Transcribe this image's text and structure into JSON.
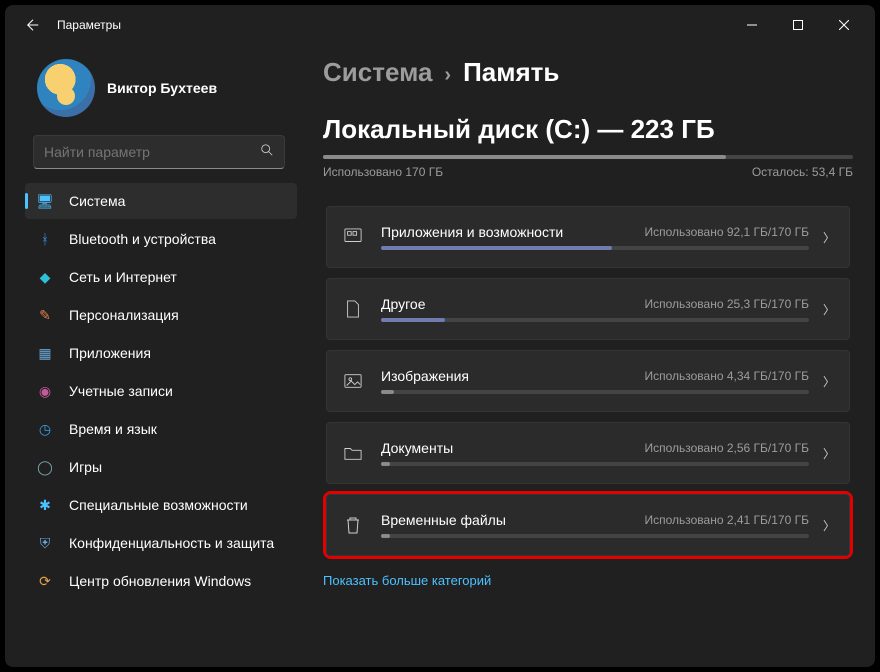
{
  "window": {
    "title": "Параметры"
  },
  "profile": {
    "name": "Виктор Бухтеев"
  },
  "search": {
    "placeholder": "Найти параметр"
  },
  "nav": [
    {
      "key": "system",
      "label": "Система",
      "icon": "🖥",
      "selected": true,
      "color": "#4cc2ff"
    },
    {
      "key": "bluetooth",
      "label": "Bluetooth и устройства",
      "icon": "ᚼ",
      "color": "#3a8ee6"
    },
    {
      "key": "network",
      "label": "Сеть и Интернет",
      "icon": "◆",
      "color": "#2ec0d6"
    },
    {
      "key": "personal",
      "label": "Персонализация",
      "icon": "✎",
      "color": "#e08050"
    },
    {
      "key": "apps",
      "label": "Приложения",
      "icon": "▦",
      "color": "#6aa6d8"
    },
    {
      "key": "accounts",
      "label": "Учетные записи",
      "icon": "◉",
      "color": "#c25b9a"
    },
    {
      "key": "time",
      "label": "Время и язык",
      "icon": "◷",
      "color": "#3aa0e6"
    },
    {
      "key": "games",
      "label": "Игры",
      "icon": "◯",
      "color": "#7aa6b0"
    },
    {
      "key": "access",
      "label": "Специальные возможности",
      "icon": "✱",
      "color": "#4cc2ff"
    },
    {
      "key": "privacy",
      "label": "Конфиденциальность и защита",
      "icon": "⛨",
      "color": "#6aa6d8"
    },
    {
      "key": "update",
      "label": "Центр обновления Windows",
      "icon": "⟳",
      "color": "#e0a050"
    }
  ],
  "breadcrumb": {
    "root": "Система",
    "current": "Память"
  },
  "disk": {
    "title": "Локальный диск (C:) — 223 ГБ",
    "used_label": "Использовано 170 ГБ",
    "free_label": "Осталось: 53,4 ГБ",
    "used_pct": 76
  },
  "categories": [
    {
      "key": "apps",
      "label": "Приложения и возможности",
      "meta": "Использовано 92,1 ГБ/170 ГБ",
      "pct": 54,
      "fill": "blue",
      "icon": "grid"
    },
    {
      "key": "other",
      "label": "Другое",
      "meta": "Использовано 25,3 ГБ/170 ГБ",
      "pct": 15,
      "fill": "blue",
      "icon": "file"
    },
    {
      "key": "images",
      "label": "Изображения",
      "meta": "Использовано 4,34 ГБ/170 ГБ",
      "pct": 3,
      "fill": "gray",
      "icon": "image"
    },
    {
      "key": "docs",
      "label": "Документы",
      "meta": "Использовано 2,56 ГБ/170 ГБ",
      "pct": 2,
      "fill": "gray",
      "icon": "folder"
    },
    {
      "key": "temp",
      "label": "Временные файлы",
      "meta": "Использовано 2,41 ГБ/170 ГБ",
      "pct": 2,
      "fill": "gray",
      "icon": "trash",
      "highlight": true
    }
  ],
  "more_link": "Показать больше категорий"
}
